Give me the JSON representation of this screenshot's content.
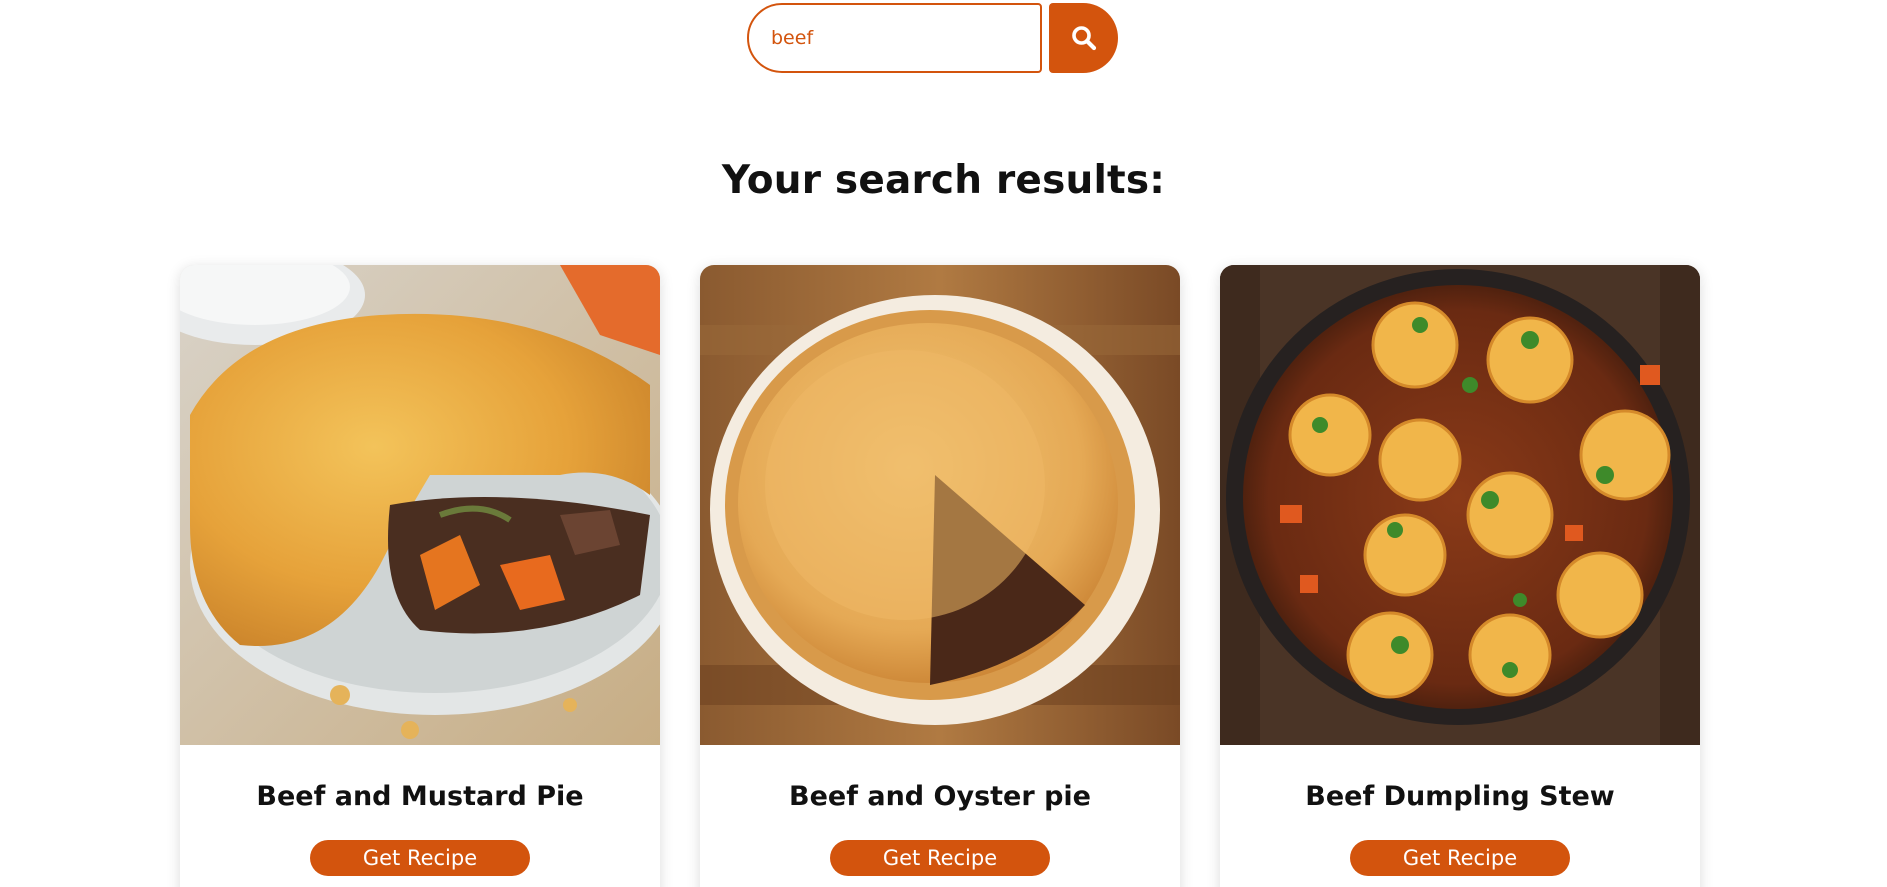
{
  "search": {
    "value": "beef",
    "icon": "search-icon"
  },
  "results": {
    "title": "Your search results:"
  },
  "cards": [
    {
      "title": "Beef and Mustard Pie",
      "button_label": "Get Recipe",
      "image": "beef-and-mustard-pie-photo"
    },
    {
      "title": "Beef and Oyster pie",
      "button_label": "Get Recipe",
      "image": "beef-and-oyster-pie-photo"
    },
    {
      "title": "Beef Dumpling Stew",
      "button_label": "Get Recipe",
      "image": "beef-dumpling-stew-photo"
    }
  ],
  "colors": {
    "accent": "#d3540d",
    "heading": "#111111",
    "background": "#ffffff"
  }
}
